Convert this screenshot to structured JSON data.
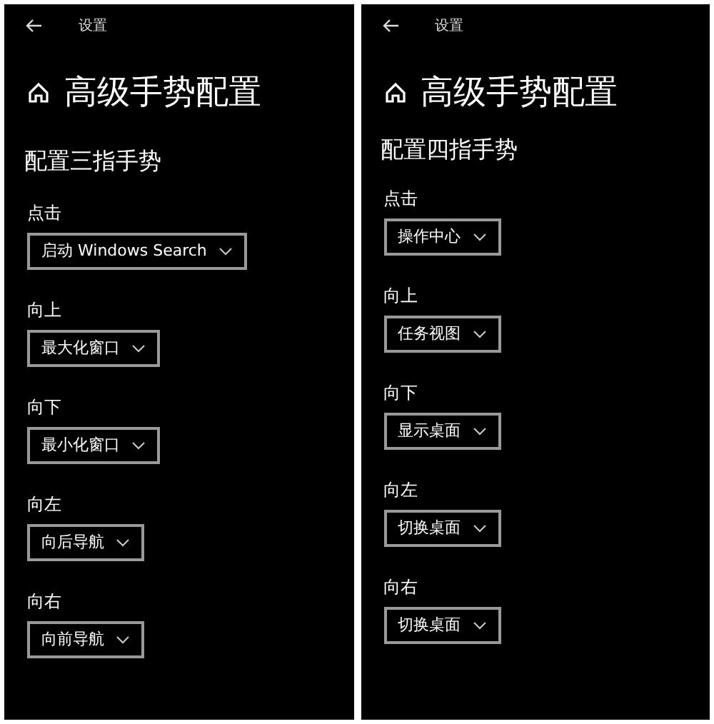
{
  "panels": [
    {
      "header": "设置",
      "title": "高级手势配置",
      "section": "配置三指手势",
      "settings": [
        {
          "label": "点击",
          "value": "启动 Windows Search"
        },
        {
          "label": "向上",
          "value": "最大化窗口"
        },
        {
          "label": "向下",
          "value": "最小化窗口"
        },
        {
          "label": "向左",
          "value": "向后导航"
        },
        {
          "label": "向右",
          "value": "向前导航"
        }
      ]
    },
    {
      "header": "设置",
      "title": "高级手势配置",
      "section": "配置四指手势",
      "settings": [
        {
          "label": "点击",
          "value": "操作中心"
        },
        {
          "label": "向上",
          "value": "任务视图"
        },
        {
          "label": "向下",
          "value": "显示桌面"
        },
        {
          "label": "向左",
          "value": "切换桌面"
        },
        {
          "label": "向右",
          "value": "切换桌面"
        }
      ]
    }
  ]
}
